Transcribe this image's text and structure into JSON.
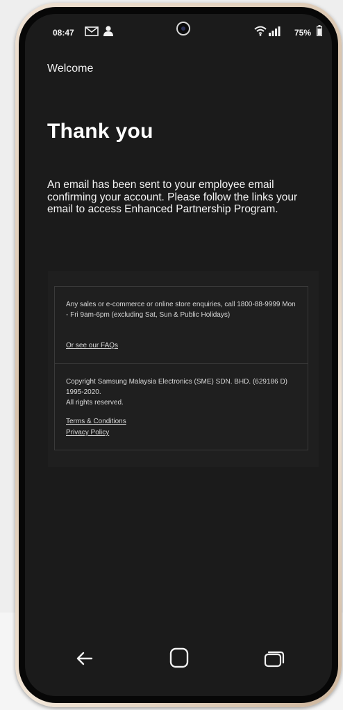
{
  "status_bar": {
    "time": "08:47",
    "battery": "75%",
    "icons": [
      "mail-icon",
      "person-icon",
      "front-camera",
      "wifi-icon",
      "signal-icon",
      "battery-icon"
    ]
  },
  "page": {
    "header": "Welcome",
    "title": "Thank you",
    "message": "An email has been sent to your employee email confirming your account. Please follow the links your email to access Enhanced Partnership Program."
  },
  "footer": {
    "enquiries": "Any sales or e-commerce or online store enquiries, call 1800-88-9999 Mon - Fri 9am-6pm (excluding Sat, Sun & Public Holidays)",
    "faq_link": "Or see our FAQs",
    "copyright_line1": "Copyright Samsung Malaysia Electronics (SME) SDN. BHD. (629186 D) 1995-2020.",
    "copyright_line2": "All rights reserved.",
    "terms_link": "Terms & Conditions",
    "privacy_link": "Privacy Policy"
  },
  "nav_bar": {
    "buttons": [
      "back-icon",
      "home-icon",
      "recents-icon"
    ]
  },
  "colors": {
    "screen_background": "#1b1b1b",
    "text": "#f5f5f5",
    "border": "#3a3a3a"
  }
}
